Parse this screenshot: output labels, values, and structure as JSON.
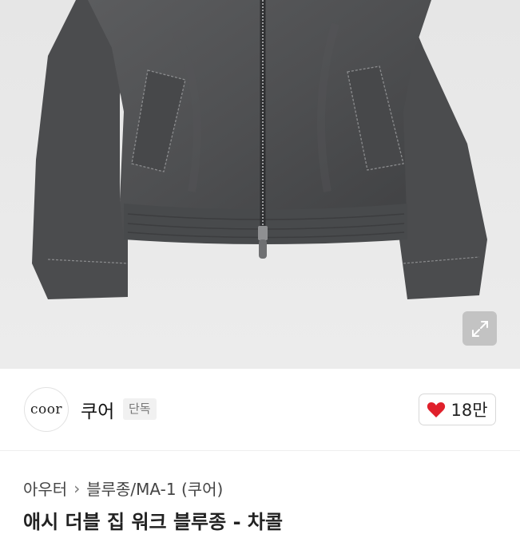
{
  "product_image": {
    "alt": "Charcoal bomber jacket with zipper",
    "expand_icon": "expand-icon"
  },
  "brand": {
    "logo_text": "coor",
    "name": "쿠어",
    "badge": "단독"
  },
  "like": {
    "icon": "heart-icon",
    "color": "#e0202b",
    "count": "18만"
  },
  "breadcrumb": {
    "items": [
      "아우터",
      "블루종/MA-1 (쿠어)"
    ],
    "separator_icon": "chevron-right-icon"
  },
  "product": {
    "title": "애시 더블 집 워크 블루종 - 차콜"
  }
}
